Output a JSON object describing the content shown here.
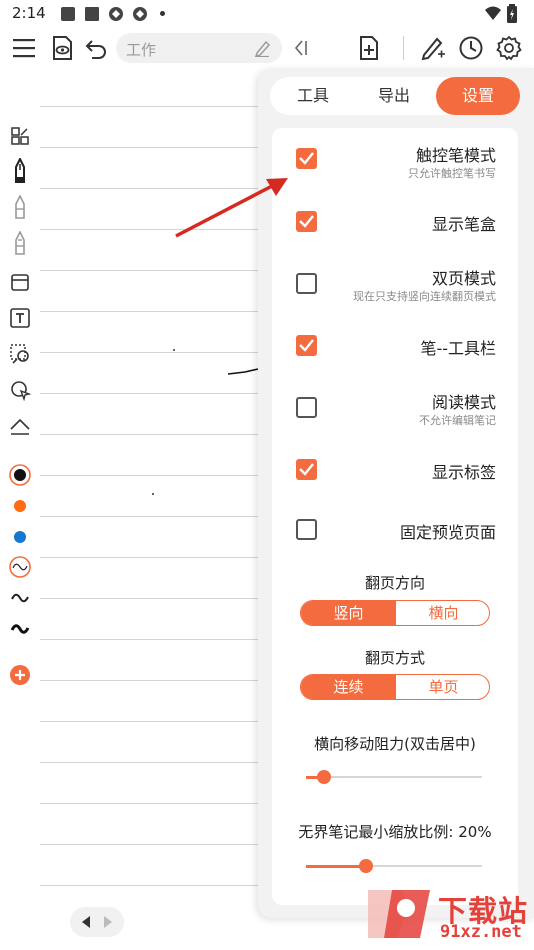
{
  "status_bar": {
    "time": "2:14",
    "icons": [
      "app-square-icon",
      "app-square-icon",
      "sync-icon",
      "sync-icon",
      "dot-icon",
      "wifi-icon",
      "battery-icon"
    ]
  },
  "toolbar": {
    "document_title": "工作",
    "icons": [
      "menu-icon",
      "read-mode-icon",
      "undo-icon",
      "edit-title-icon",
      "collapse-icon",
      "add-page-icon",
      "pen-settings-icon",
      "history-icon",
      "settings-icon"
    ]
  },
  "left_tools": {
    "icons": [
      "layout-icon",
      "fountain-pen-icon",
      "pencil-icon",
      "marker-icon",
      "eraser-icon",
      "text-box-icon",
      "lasso-icon",
      "shape-icon",
      "ruler-icon"
    ],
    "colors": [
      "#111111",
      "#ff6a13",
      "#1677d2"
    ],
    "stroke_icons": [
      "stroke-thin-icon",
      "stroke-medium-icon",
      "stroke-thick-icon"
    ],
    "add_icon": "add-color-icon"
  },
  "panel": {
    "tabs": [
      "工具",
      "导出",
      "设置"
    ],
    "active_tab": "设置",
    "accent_color": "#f36b3e",
    "options": [
      {
        "label": "触控笔模式",
        "sub": "只允许触控笔书写",
        "checked": true
      },
      {
        "label": "显示笔盒",
        "sub": "",
        "checked": true
      },
      {
        "label": "双页模式",
        "sub": "现在只支持竖向连续翻页模式",
        "checked": false
      },
      {
        "label": "笔--工具栏",
        "sub": "",
        "checked": true
      },
      {
        "label": "阅读模式",
        "sub": "不允许编辑笔记",
        "checked": false
      },
      {
        "label": "显示标签",
        "sub": "",
        "checked": true
      },
      {
        "label": "固定预览页面",
        "sub": "",
        "checked": false
      }
    ],
    "page_direction": {
      "title": "翻页方向",
      "options": [
        "竖向",
        "横向"
      ],
      "selected": "竖向"
    },
    "page_mode": {
      "title": "翻页方式",
      "options": [
        "连续",
        "单页"
      ],
      "selected": "连续"
    },
    "resistance": {
      "title": "横向移动阻力(双击居中)",
      "value": 0.1
    },
    "zoom": {
      "title": "无界笔记最小缩放比例: 20%",
      "value": 0.34
    }
  },
  "watermark": {
    "text1": "下载站",
    "text2": "91xz.net"
  }
}
